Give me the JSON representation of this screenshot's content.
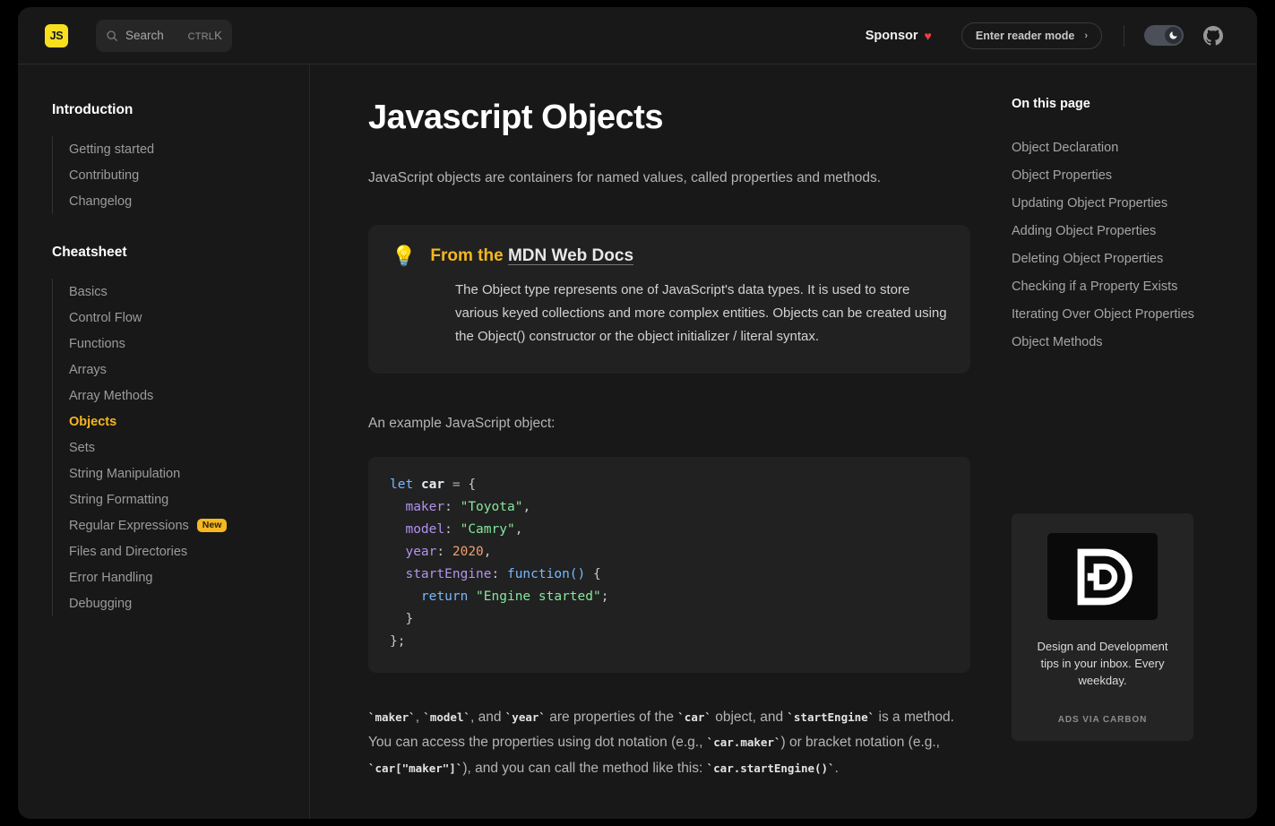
{
  "header": {
    "logo_text": "JS",
    "search": {
      "placeholder": "Search",
      "shortcut_mod": "CTRL",
      "shortcut_key": "K"
    },
    "sponsor_label": "Sponsor",
    "heart_glyph": "♥",
    "reader_mode_label": "Enter reader mode",
    "reader_chevron": "›",
    "theme_mode": "dark",
    "github_label": "GitHub"
  },
  "sidebar": {
    "groups": [
      {
        "title": "Introduction",
        "items": [
          {
            "label": "Getting started",
            "active": false
          },
          {
            "label": "Contributing",
            "active": false
          },
          {
            "label": "Changelog",
            "active": false
          }
        ]
      },
      {
        "title": "Cheatsheet",
        "items": [
          {
            "label": "Basics",
            "active": false
          },
          {
            "label": "Control Flow",
            "active": false
          },
          {
            "label": "Functions",
            "active": false
          },
          {
            "label": "Arrays",
            "active": false
          },
          {
            "label": "Array Methods",
            "active": false
          },
          {
            "label": "Objects",
            "active": true
          },
          {
            "label": "Sets",
            "active": false
          },
          {
            "label": "String Manipulation",
            "active": false
          },
          {
            "label": "String Formatting",
            "active": false
          },
          {
            "label": "Regular Expressions",
            "active": false,
            "badge": "New"
          },
          {
            "label": "Files and Directories",
            "active": false
          },
          {
            "label": "Error Handling",
            "active": false
          },
          {
            "label": "Debugging",
            "active": false
          }
        ]
      }
    ]
  },
  "main": {
    "title": "Javascript Objects",
    "intro": "JavaScript objects are containers for named values, called properties and methods.",
    "callout": {
      "icon": "💡",
      "title_prefix": "From the ",
      "link_text": "MDN Web Docs",
      "body": "The Object type represents one of JavaScript's data types. It is used to store various keyed collections and more complex entities. Objects can be created using the Object() constructor or the object initializer / literal syntax."
    },
    "example_label": "An example JavaScript object:",
    "code": {
      "language": "javascript",
      "lines": [
        "let car = {",
        "  maker: \"Toyota\",",
        "  model: \"Camry\",",
        "  year: 2020,",
        "  startEngine: function() {",
        "    return \"Engine started\";",
        "  }",
        "};"
      ],
      "tokens": {
        "kw_let": "let",
        "name_car": "car",
        "eq": "=",
        "brace_open": "{",
        "prop_maker": "maker",
        "str_toyota": "\"Toyota\"",
        "prop_model": "model",
        "str_camry": "\"Camry\"",
        "prop_year": "year",
        "num_2020": "2020",
        "prop_startengine": "startEngine",
        "kw_function": "function()",
        "kw_return": "return",
        "str_engine_started": "\"Engine started\"",
        "brace_close": "}",
        "end": "};"
      }
    },
    "outro": {
      "seg1": "`maker`",
      "seg2": ", ",
      "seg3": "`model`",
      "seg4": ", and ",
      "seg5": "`year`",
      "seg6": " are properties of the ",
      "seg7": "`car`",
      "seg8": " object, and ",
      "seg9": "`startEngine`",
      "seg10": " is a method. You can access the properties using dot notation (e.g., ",
      "seg11": "`car.maker`",
      "seg12": ") or bracket notation (e.g., ",
      "seg13": "`car[\"maker\"]`",
      "seg14": "), and you can call the method like this: ",
      "seg15": "`car.startEngine()`",
      "seg16": "."
    }
  },
  "toc": {
    "title": "On this page",
    "items": [
      "Object Declaration",
      "Object Properties",
      "Updating Object Properties",
      "Adding Object Properties",
      "Deleting Object Properties",
      "Checking if a Property Exists",
      "Iterating Over Object Properties",
      "Object Methods"
    ]
  },
  "ad": {
    "logo_alt": "Design and Development D logo",
    "text": "Design and Development tips in your inbox. Every weekday.",
    "via": "ADS VIA CARBON"
  },
  "colors": {
    "accent": "#f5b722",
    "brand_js": "#f7df1e",
    "heart": "#e8413f",
    "page_bg": "#181818",
    "panel_bg": "#212121",
    "outer_bg": "#000000"
  }
}
